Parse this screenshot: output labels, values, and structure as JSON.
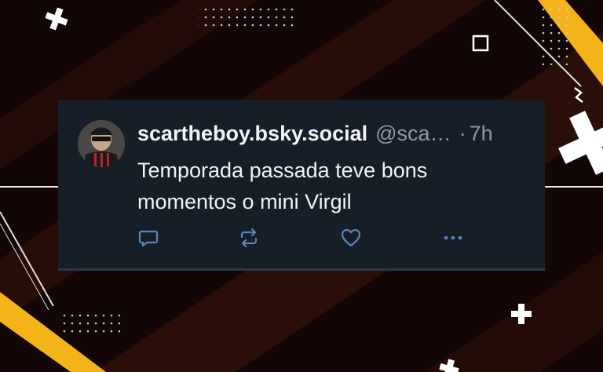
{
  "post": {
    "display_name": "scartheboy.bsky.social",
    "handle": "@sca…",
    "separator": "·",
    "time": "7h",
    "text": "Temporada passada teve bons momentos o mini Virgil",
    "avatar_icon": "user-avatar",
    "actions": [
      {
        "icon": "reply-icon"
      },
      {
        "icon": "repost-icon"
      },
      {
        "icon": "like-icon"
      },
      {
        "icon": "more-icon"
      }
    ]
  },
  "colors": {
    "background": "#120606",
    "stripe": "#2a0f08",
    "accent_yellow": "#f5b31a",
    "card": "#161e27",
    "text_primary": "#f1f4f7",
    "text_secondary": "#8c98a5",
    "action_icon": "#5b86b8"
  }
}
